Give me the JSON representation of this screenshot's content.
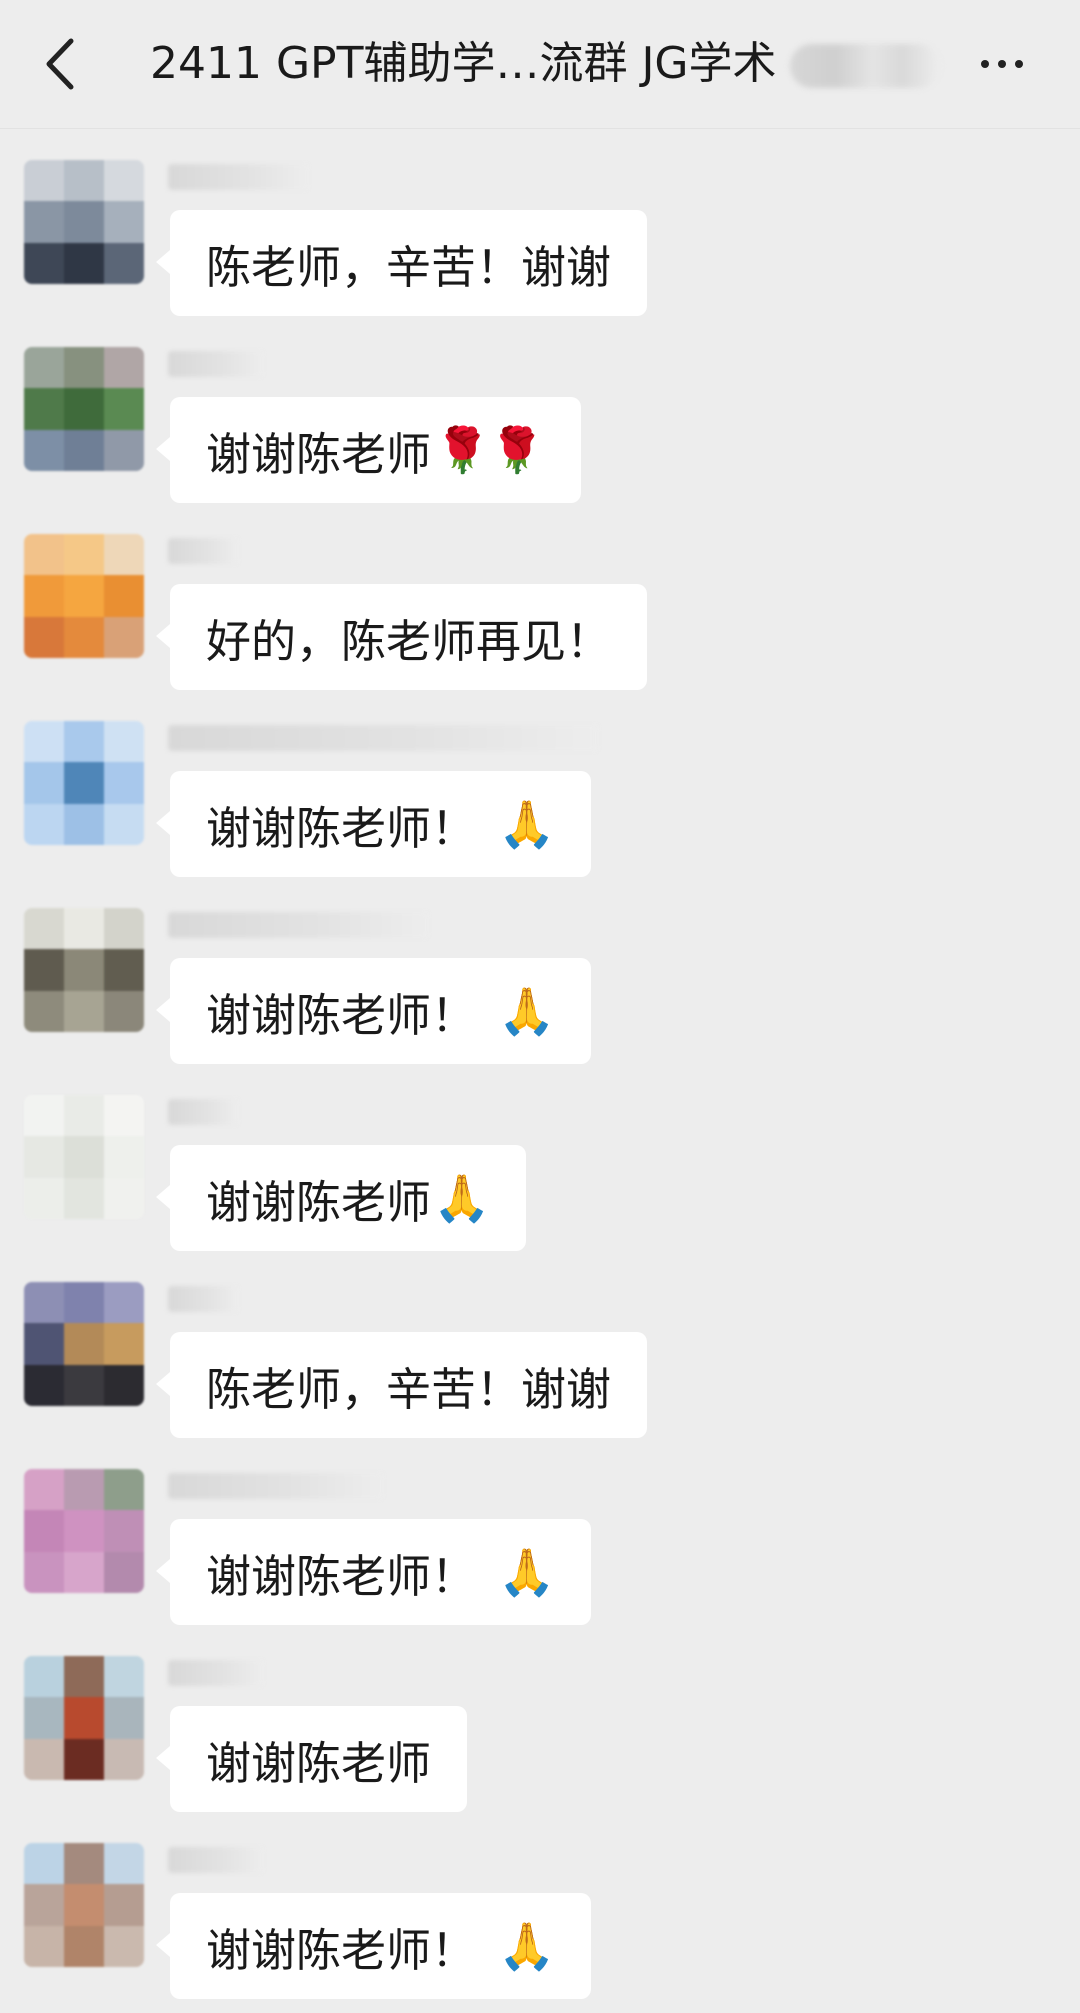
{
  "header": {
    "title": "2411 GPT辅助学…流群 JG学术"
  },
  "messages": [
    {
      "text": "陈老师，辛苦！谢谢",
      "emoji": "",
      "emoji_kind": ""
    },
    {
      "text": "谢谢陈老师",
      "emoji": "🌹🌹",
      "emoji_kind": "rose"
    },
    {
      "text": "好的，陈老师再见！",
      "emoji": "",
      "emoji_kind": ""
    },
    {
      "text": "谢谢陈老师！",
      "emoji": "🙏",
      "emoji_kind": "hands"
    },
    {
      "text": "谢谢陈老师！",
      "emoji": "🙏",
      "emoji_kind": "hands"
    },
    {
      "text": "谢谢陈老师",
      "emoji": "🙏",
      "emoji_kind": "hands-tight"
    },
    {
      "text": "陈老师，辛苦！谢谢",
      "emoji": "",
      "emoji_kind": ""
    },
    {
      "text": "谢谢陈老师！",
      "emoji": "🙏",
      "emoji_kind": "hands"
    },
    {
      "text": "谢谢陈老师",
      "emoji": "",
      "emoji_kind": ""
    },
    {
      "text": "谢谢陈老师！",
      "emoji": "🙏",
      "emoji_kind": "hands"
    }
  ],
  "colors": {
    "background": "#ededed",
    "bubble": "#ffffff",
    "text": "#1a1a1a"
  },
  "icons": {
    "back": "chevron-left-icon",
    "more": "more-dots-icon"
  }
}
